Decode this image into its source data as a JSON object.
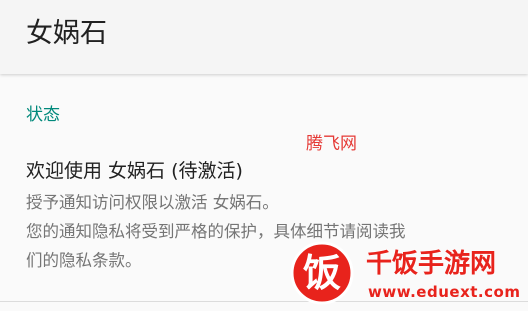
{
  "app_bar": {
    "title": "女娲石"
  },
  "section": {
    "header": "状态"
  },
  "item": {
    "title": "欢迎使用 女娲石 (待激活)",
    "summary_lines": [
      "授予通知访问权限以激活 女娲石。",
      "您的通知隐私将受到严格的保护，具体细节请阅读我",
      "们的隐私条款。"
    ]
  },
  "watermarks": {
    "small_text": "腾飞网",
    "logo_char": "饭",
    "logo_name": "千饭手游网",
    "logo_url": "www.eduext.com"
  },
  "colors": {
    "accent": "#00897b",
    "watermark_red": "#e8231c"
  }
}
